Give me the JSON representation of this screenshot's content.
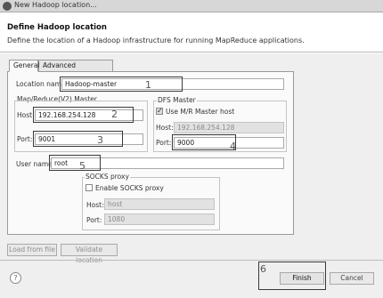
{
  "window": {
    "title": "New Hadoop location..."
  },
  "header": {
    "title": "Define Hadoop location",
    "description": "Define the location of a Hadoop infrastructure for running MapReduce applications."
  },
  "tabs": [
    {
      "label": "General"
    },
    {
      "label": "Advanced parameters"
    }
  ],
  "general": {
    "location_name_label": "Location name:",
    "location_name_value": "Hadoop-master",
    "mapreduce": {
      "group_title": "Map/Reduce(V2) Master",
      "host_label": "Host:",
      "host_value": "192.168.254.128",
      "port_label": "Port:",
      "port_value": "9001"
    },
    "dfs": {
      "group_title": "DFS Master",
      "use_master_label": "Use M/R Master host",
      "use_master_checked": true,
      "host_label": "Host:",
      "host_value": "192.168.254.128",
      "port_label": "Port:",
      "port_value": "9000"
    },
    "user_name_label": "User name:",
    "user_name_value": "root",
    "socks": {
      "group_title": "SOCKS proxy",
      "enable_label": "Enable SOCKS proxy",
      "enable_checked": false,
      "host_label": "Host:",
      "host_value": "host",
      "port_label": "Port:",
      "port_value": "1080"
    }
  },
  "annotations": [
    "1",
    "2",
    "3",
    "4",
    "5",
    "6"
  ],
  "footer": {
    "load_from_file": "Load from file",
    "validate_location": "Validate location",
    "help_glyph": "?",
    "finish": "Finish",
    "cancel": "Cancel"
  }
}
